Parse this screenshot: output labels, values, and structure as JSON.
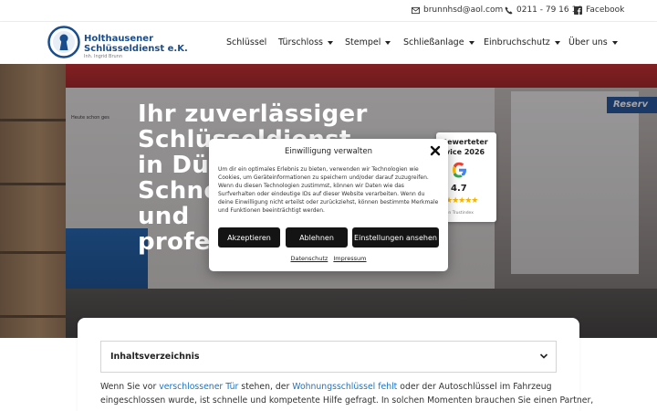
{
  "topbar": {
    "email": "brunnhsd@aol.com",
    "phone": "0211 - 79 16 16",
    "facebook": "Facebook",
    "email_icon": "envelope-icon",
    "phone_icon": "phone-icon",
    "facebook_icon": "facebook-icon"
  },
  "brand": {
    "line1": "Holthausener",
    "line2": "Schlüsseldienst e.K.",
    "owner": "Inh. Ingrid Brunn",
    "color": "#1a4d8c"
  },
  "nav": {
    "items": [
      {
        "label": "Schlüssel",
        "dropdown": false
      },
      {
        "label": "Türschloss",
        "dropdown": true
      },
      {
        "label": "Stempel",
        "dropdown": true
      },
      {
        "label": "Schließanlage",
        "dropdown": true
      },
      {
        "label": "Einbruchschutz",
        "dropdown": true
      },
      {
        "label": "Über uns",
        "dropdown": true
      }
    ]
  },
  "hero": {
    "lines": [
      "Ihr zuverlässiger",
      "Schlüsseldienst",
      "in Dü",
      "Schne",
      "und",
      "profe"
    ],
    "store_sign": "Reserv",
    "shelf_label": "Heute schon ges"
  },
  "rating_widget": {
    "line1": "Bewerteter",
    "line2": "rvice 2026",
    "score": "4.7",
    "stars": "★★★★★",
    "stars_value": 4.7,
    "provider": "von Trustindex"
  },
  "consent": {
    "title": "Einwilligung verwalten",
    "body": "Um dir ein optimales Erlebnis zu bieten, verwenden wir Technologien wie Cookies, um Geräteinformationen zu speichern und/oder darauf zuzugreifen. Wenn du diesen Technologien zustimmst, können wir Daten wie das Surfverhalten oder eindeutige IDs auf dieser Website verarbeiten. Wenn du deine Einwilligung nicht erteilst oder zurückziehst, können bestimmte Merkmale und Funktionen beeinträchtigt werden.",
    "accept_label": "Akzeptieren",
    "deny_label": "Ablehnen",
    "settings_label": "Einstellungen ansehen",
    "privacy_link": "Datenschutz",
    "imprint_link": "Impressum",
    "button_color": "#141414"
  },
  "content": {
    "toc_label": "Inhaltsverzeichnis",
    "para1_pre": "Wenn Sie vor ",
    "para1_link1": "verschlossener Tür",
    "para1_mid": " stehen, der ",
    "para1_link2": "Wohnungsschlüssel fehlt",
    "para1_post": " oder der Autoschlüssel im Fahrzeug",
    "para2": "eingeschlossen wurde, ist schnelle und kompetente Hilfe gefragt. In solchen Momenten brauchen Sie einen Partner,",
    "link_color": "#1a73c8"
  }
}
